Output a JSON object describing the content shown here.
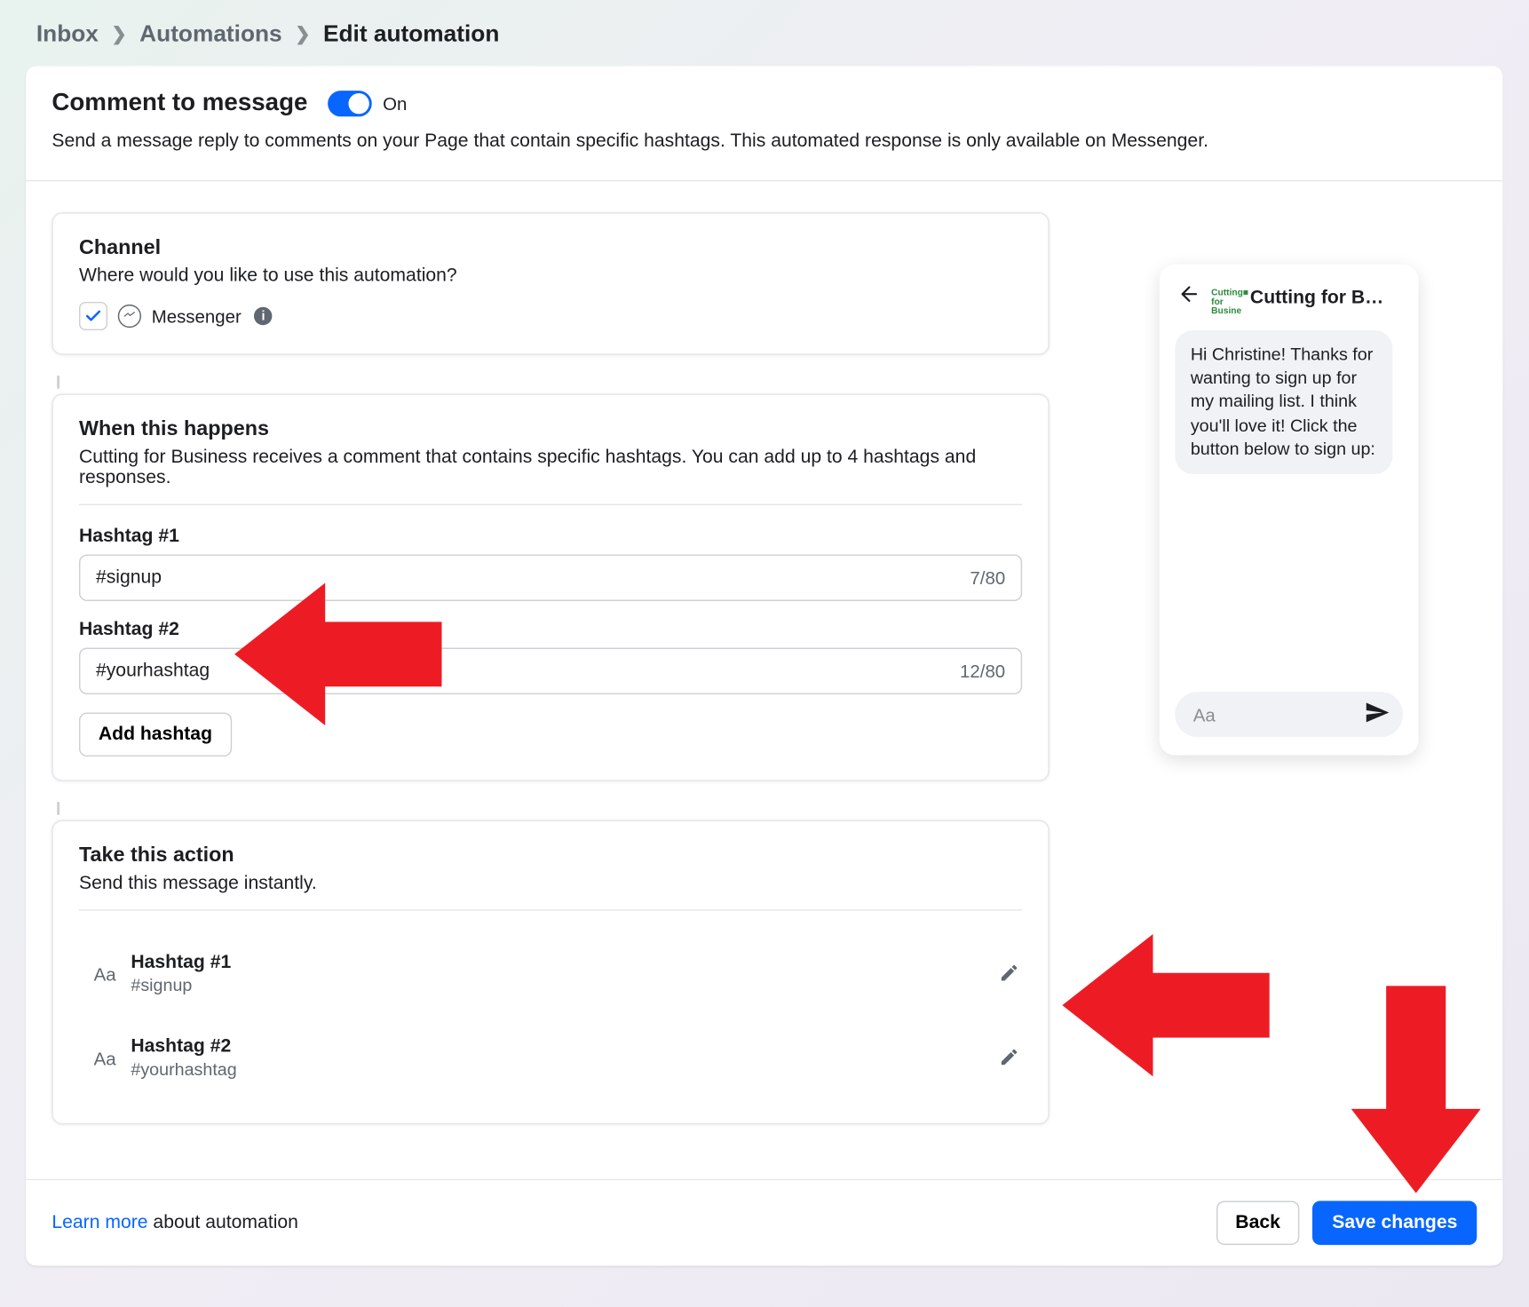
{
  "breadcrumb": {
    "inbox": "Inbox",
    "automations": "Automations",
    "current": "Edit automation"
  },
  "header": {
    "title": "Comment to message",
    "toggle_label": "On",
    "description": "Send a message reply to comments on your Page that contain specific hashtags. This automated response is only available on Messenger."
  },
  "channel": {
    "title": "Channel",
    "subtitle": "Where would you like to use this automation?",
    "option_label": "Messenger"
  },
  "when": {
    "title": "When this happens",
    "subtitle": "Cutting for Business receives a comment that contains specific hashtags. You can add up to 4 hashtags and responses.",
    "hashtags": [
      {
        "label": "Hashtag #1",
        "value": "#signup",
        "counter": "7/80"
      },
      {
        "label": "Hashtag #2",
        "value": "#yourhashtag",
        "counter": "12/80"
      }
    ],
    "add_label": "Add hashtag"
  },
  "action": {
    "title": "Take this action",
    "subtitle": "Send this message instantly.",
    "items": [
      {
        "label": "Hashtag #1",
        "sub": "#signup"
      },
      {
        "label": "Hashtag #2",
        "sub": "#yourhashtag"
      }
    ]
  },
  "preview": {
    "title": "Cutting for B…",
    "avatar_text": "Cutting for Business",
    "bubble": "Hi Christine! Thanks for wanting to sign up for my mailing list. I think you'll love it! Click the button below to sign up:",
    "placeholder": "Aa"
  },
  "footer": {
    "learn_link": "Learn more",
    "learn_rest": " about automation",
    "back": "Back",
    "save": "Save changes"
  }
}
